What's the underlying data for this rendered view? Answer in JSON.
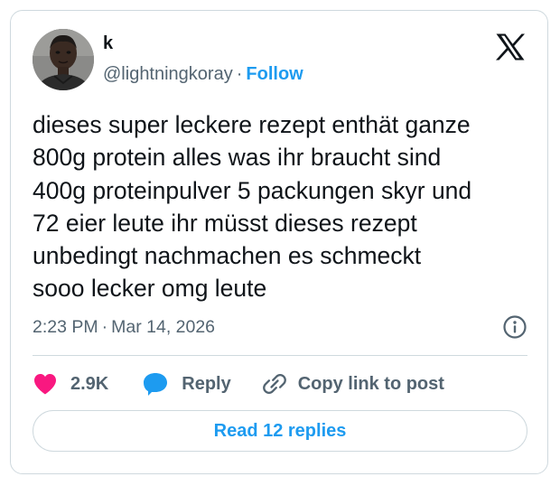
{
  "author": {
    "display_name": "k",
    "handle": "@lightningkoray",
    "separator": "·",
    "follow_label": "Follow",
    "avatar_icon": "profile-photo"
  },
  "brand": {
    "logo_icon": "x-logo",
    "accent_color": "#1d9bf0",
    "like_color": "#f91880"
  },
  "tweet": {
    "text": "dieses super leckere rezept enthät ganze\n800g protein alles was ihr braucht sind\n400g proteinpulver 5 packungen skyr und\n72 eier leute ihr müsst dieses rezept\nunbedingt nachmachen es schmeckt\nsooo lecker omg leute",
    "time": "2:23 PM",
    "separator": "·",
    "date": "Mar 14, 2026",
    "info_icon": "info-icon"
  },
  "actions": {
    "like_icon": "heart-icon",
    "like_count": "2.9K",
    "reply_icon": "speech-bubble-icon",
    "reply_label": "Reply",
    "copy_icon": "link-icon",
    "copy_label": "Copy link to post"
  },
  "replies_button": {
    "label": "Read 12 replies"
  }
}
